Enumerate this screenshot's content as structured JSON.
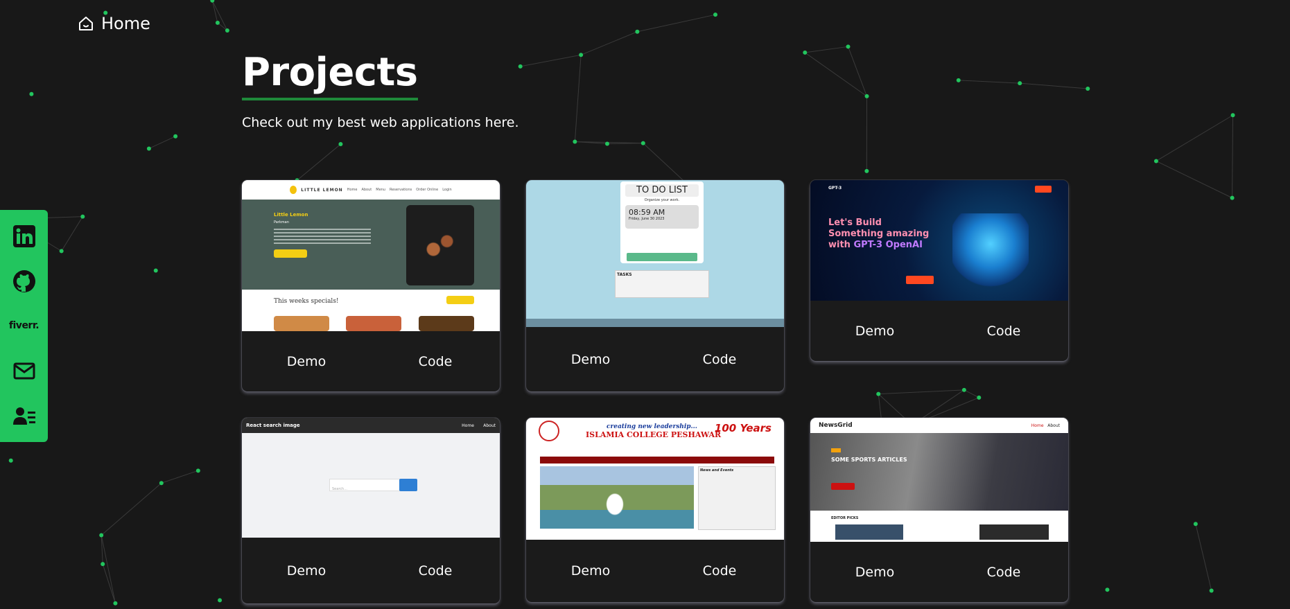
{
  "nav": {
    "home_label": "Home"
  },
  "page": {
    "title": "Projects",
    "subtitle": "Check out my best web applications here."
  },
  "social": {
    "items": [
      {
        "name": "linkedin",
        "icon": "linkedin-icon"
      },
      {
        "name": "github",
        "icon": "github-icon"
      },
      {
        "name": "fiverr",
        "icon": "fiverr-icon",
        "text": "fiverr."
      },
      {
        "name": "email",
        "icon": "mail-icon"
      },
      {
        "name": "resume",
        "icon": "contact-card-icon"
      }
    ],
    "accent": "#22c55e"
  },
  "projects": [
    {
      "thumb": {
        "brand": "LITTLE LEMON",
        "nav": [
          "Home",
          "About",
          "Menu",
          "Reservations",
          "Order Online",
          "Login"
        ],
        "hero_title": "Little Lemon",
        "hero_sub": "Parkman",
        "specials": "This weeks specials!"
      },
      "demo": "Demo",
      "code": "Code"
    },
    {
      "thumb": {
        "title": "TO DO LIST",
        "subtitle": "Organize your work.",
        "time": "08:59 AM",
        "date": "Friday, June 30 2023",
        "tasks": "TASKS"
      },
      "demo": "Demo",
      "code": "Code"
    },
    {
      "thumb": {
        "brand": "GPT-3",
        "headline_a": "Let's Build Something amazing with ",
        "headline_b": "GPT-3 OpenAI"
      },
      "demo": "Demo",
      "code": "Code"
    },
    {
      "thumb": {
        "brand": "React search image",
        "nav": [
          "Home",
          "About"
        ],
        "placeholder": "Search..."
      },
      "demo": "Demo",
      "code": "Code"
    },
    {
      "thumb": {
        "tagline": "creating new leadership...",
        "college": "ISLAMIA COLLEGE PESHAWAR",
        "years": "100 Years",
        "news_title": "News and Events"
      },
      "demo": "Demo",
      "code": "Code"
    },
    {
      "thumb": {
        "brand": "NewsGrid",
        "nav": [
          "Home",
          "About"
        ],
        "hero": "SOME SPORTS ARTICLES",
        "picks": "EDITOR PICKS"
      },
      "demo": "Demo",
      "code": "Code"
    }
  ],
  "colors": {
    "background": "#181818",
    "title_underline": "#1f8a3a",
    "particles": "#22c55e"
  }
}
